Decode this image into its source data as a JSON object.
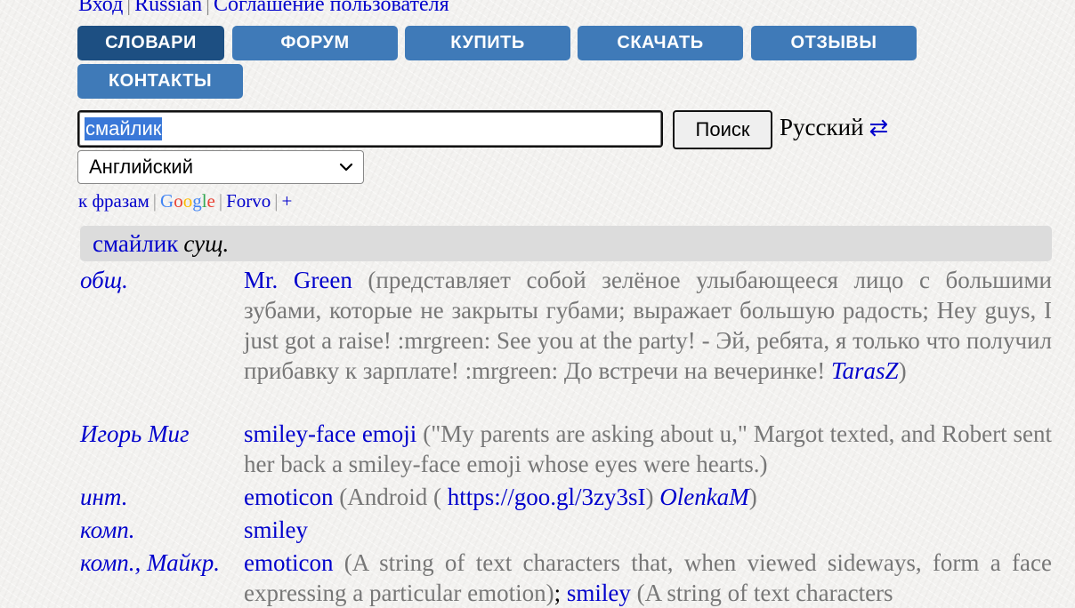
{
  "top_nav": {
    "login": "Вход",
    "language": "Russian",
    "agreement": "Соглашение пользователя"
  },
  "menu": [
    {
      "label": "СЛОВАРИ",
      "active": true
    },
    {
      "label": "ФОРУМ",
      "active": false
    },
    {
      "label": "КУПИТЬ",
      "active": false
    },
    {
      "label": "СКАЧАТЬ",
      "active": false
    },
    {
      "label": "ОТЗЫВЫ",
      "active": false
    },
    {
      "label": "КОНТАКТЫ",
      "active": false
    }
  ],
  "search": {
    "value": "смайлик",
    "button_label": "Поиск",
    "source_language": "Русский",
    "swap_icon": "⇄",
    "target_language": "Английский"
  },
  "links": {
    "phrases": "к фразам",
    "google": [
      "G",
      "o",
      "o",
      "g",
      "l",
      "e"
    ],
    "forvo": "Forvo",
    "plus": "+"
  },
  "headword": {
    "word": "смайлик",
    "pos": "сущ."
  },
  "entries": [
    {
      "subject": "общ.",
      "term": "Mr. Green",
      "note": " (представляет собой зелёное улыбающееся лицо с большими зубами, которые не закрыты губами; выражает большую радость; Hey guys, I just got a raise! :mrgreen: See you at the party! - Эй, ребята, я только что получил прибавку к зарплате! :mrgreen: До встречи на вечеринке! ",
      "author": "TarasZ",
      "close": ")"
    },
    {
      "subject": "Игорь Миг",
      "term": "smiley-face emoji",
      "note": " (\"My parents are asking about u,\" Margot texted, and Robert sent her back a smiley-face emoji whose eyes were hearts.)"
    },
    {
      "subject": "инт.",
      "term": "emoticon",
      "note_pre": " (Android ( ",
      "link": "https://goo.gl/3zy3sI",
      "note_mid": ") ",
      "author": "OlenkaM",
      "close": ")"
    },
    {
      "subject": "комп.",
      "term": "smiley"
    },
    {
      "subject": "комп., Майкр.",
      "term": "emoticon",
      "note": " (A string of text characters that, when viewed sideways, form a face expressing a particular emotion)",
      "sep": "; ",
      "term2": "smiley",
      "note2": " (A string of text characters"
    }
  ],
  "colors": {
    "menu_button": "#3f7ab8",
    "menu_button_active": "#1d4f82",
    "link": "#0000cc",
    "gray_text": "#777777",
    "headbar": "#dcdcdc"
  }
}
